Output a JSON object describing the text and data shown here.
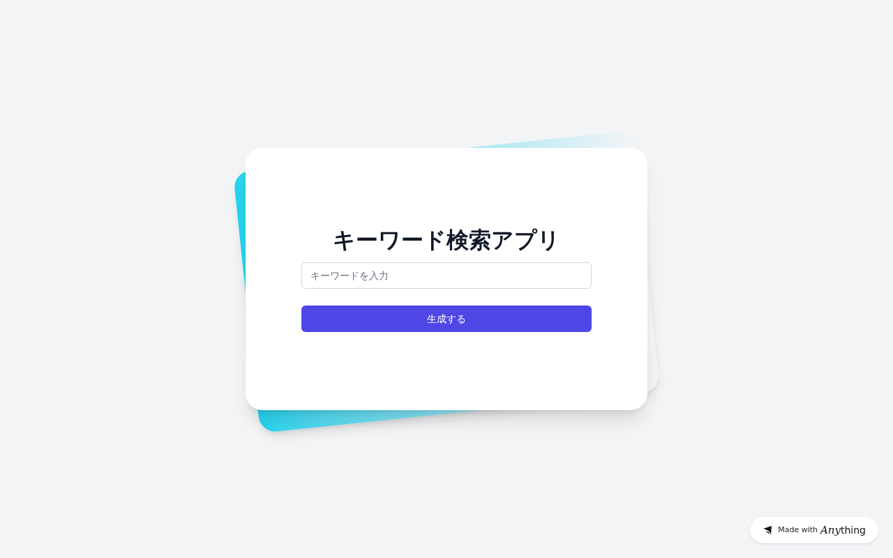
{
  "title": "キーワード検索アプリ",
  "search": {
    "placeholder": "キーワードを入力"
  },
  "button": "生成する",
  "badge": {
    "text": "Made with",
    "brand_styled": "Any",
    "brand_rest": "thing"
  }
}
